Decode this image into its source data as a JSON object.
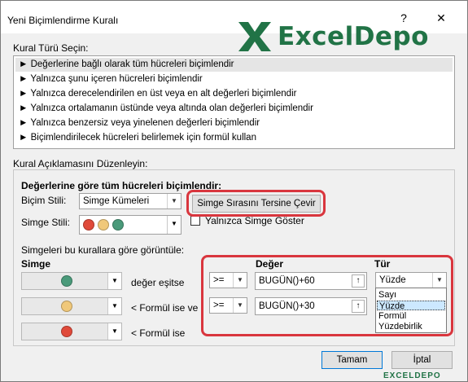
{
  "window": {
    "title": "Yeni Biçimlendirme Kuralı",
    "help": "?",
    "close": "✕"
  },
  "logo": {
    "text": "ExcelDepo",
    "color": "#217346"
  },
  "rule_type": {
    "label": "Kural Türü Seçin:",
    "items": [
      "Değerlerine bağlı olarak tüm hücreleri biçimlendir",
      "Yalnızca şunu içeren hücreleri biçimlendir",
      "Yalnızca derecelendirilen en üst veya en alt değerleri biçimlendir",
      "Yalnızca ortalamanın üstünde veya altında olan değerleri biçimlendir",
      "Yalnızca benzersiz veya yinelenen değerleri biçimlendir",
      "Biçimlendirilecek hücreleri belirlemek için formül kullan"
    ],
    "selected_index": 0,
    "item_prefix": "►"
  },
  "edit": {
    "label": "Kural Açıklamasını Düzenleyin:",
    "heading": "Değerlerine göre tüm hücreleri biçimlendir:",
    "format_style_label": "Biçim Stili:",
    "format_style_value": "Simge Kümeleri",
    "reverse_button": "Simge Sırasını Tersine Çevir",
    "icon_style_label": "Simge Stili:",
    "show_icon_only_label": "Yalnızca Simge Göster",
    "show_icon_only_checked": false,
    "rules_heading": "Simgeleri bu kurallara göre görüntüle:",
    "col_icon": "Simge",
    "col_value": "Değer",
    "col_type": "Tür",
    "rows": [
      {
        "icon_color": "#4a9a7a",
        "condition": "değer eşitse",
        "operator": ">=",
        "value": "BUGÜN()+60",
        "type": "Yüzde"
      },
      {
        "icon_color": "#f0c87a",
        "condition": "< Formül ise ve",
        "operator": ">=",
        "value": "BUGÜN()+30",
        "type": ""
      },
      {
        "icon_color": "#e04a3a",
        "condition": "< Formül ise"
      }
    ],
    "icon_style_colors": [
      "#e04a3a",
      "#f0c87a",
      "#4a9a7a"
    ],
    "type_options": [
      "Sayı",
      "Yüzde",
      "Formül",
      "Yüzdebirlik"
    ],
    "type_selected": "Yüzde"
  },
  "buttons": {
    "ok": "Tamam",
    "cancel": "İptal"
  },
  "watermark": "EXCELDEPO",
  "highlight_color": "#d9363e"
}
